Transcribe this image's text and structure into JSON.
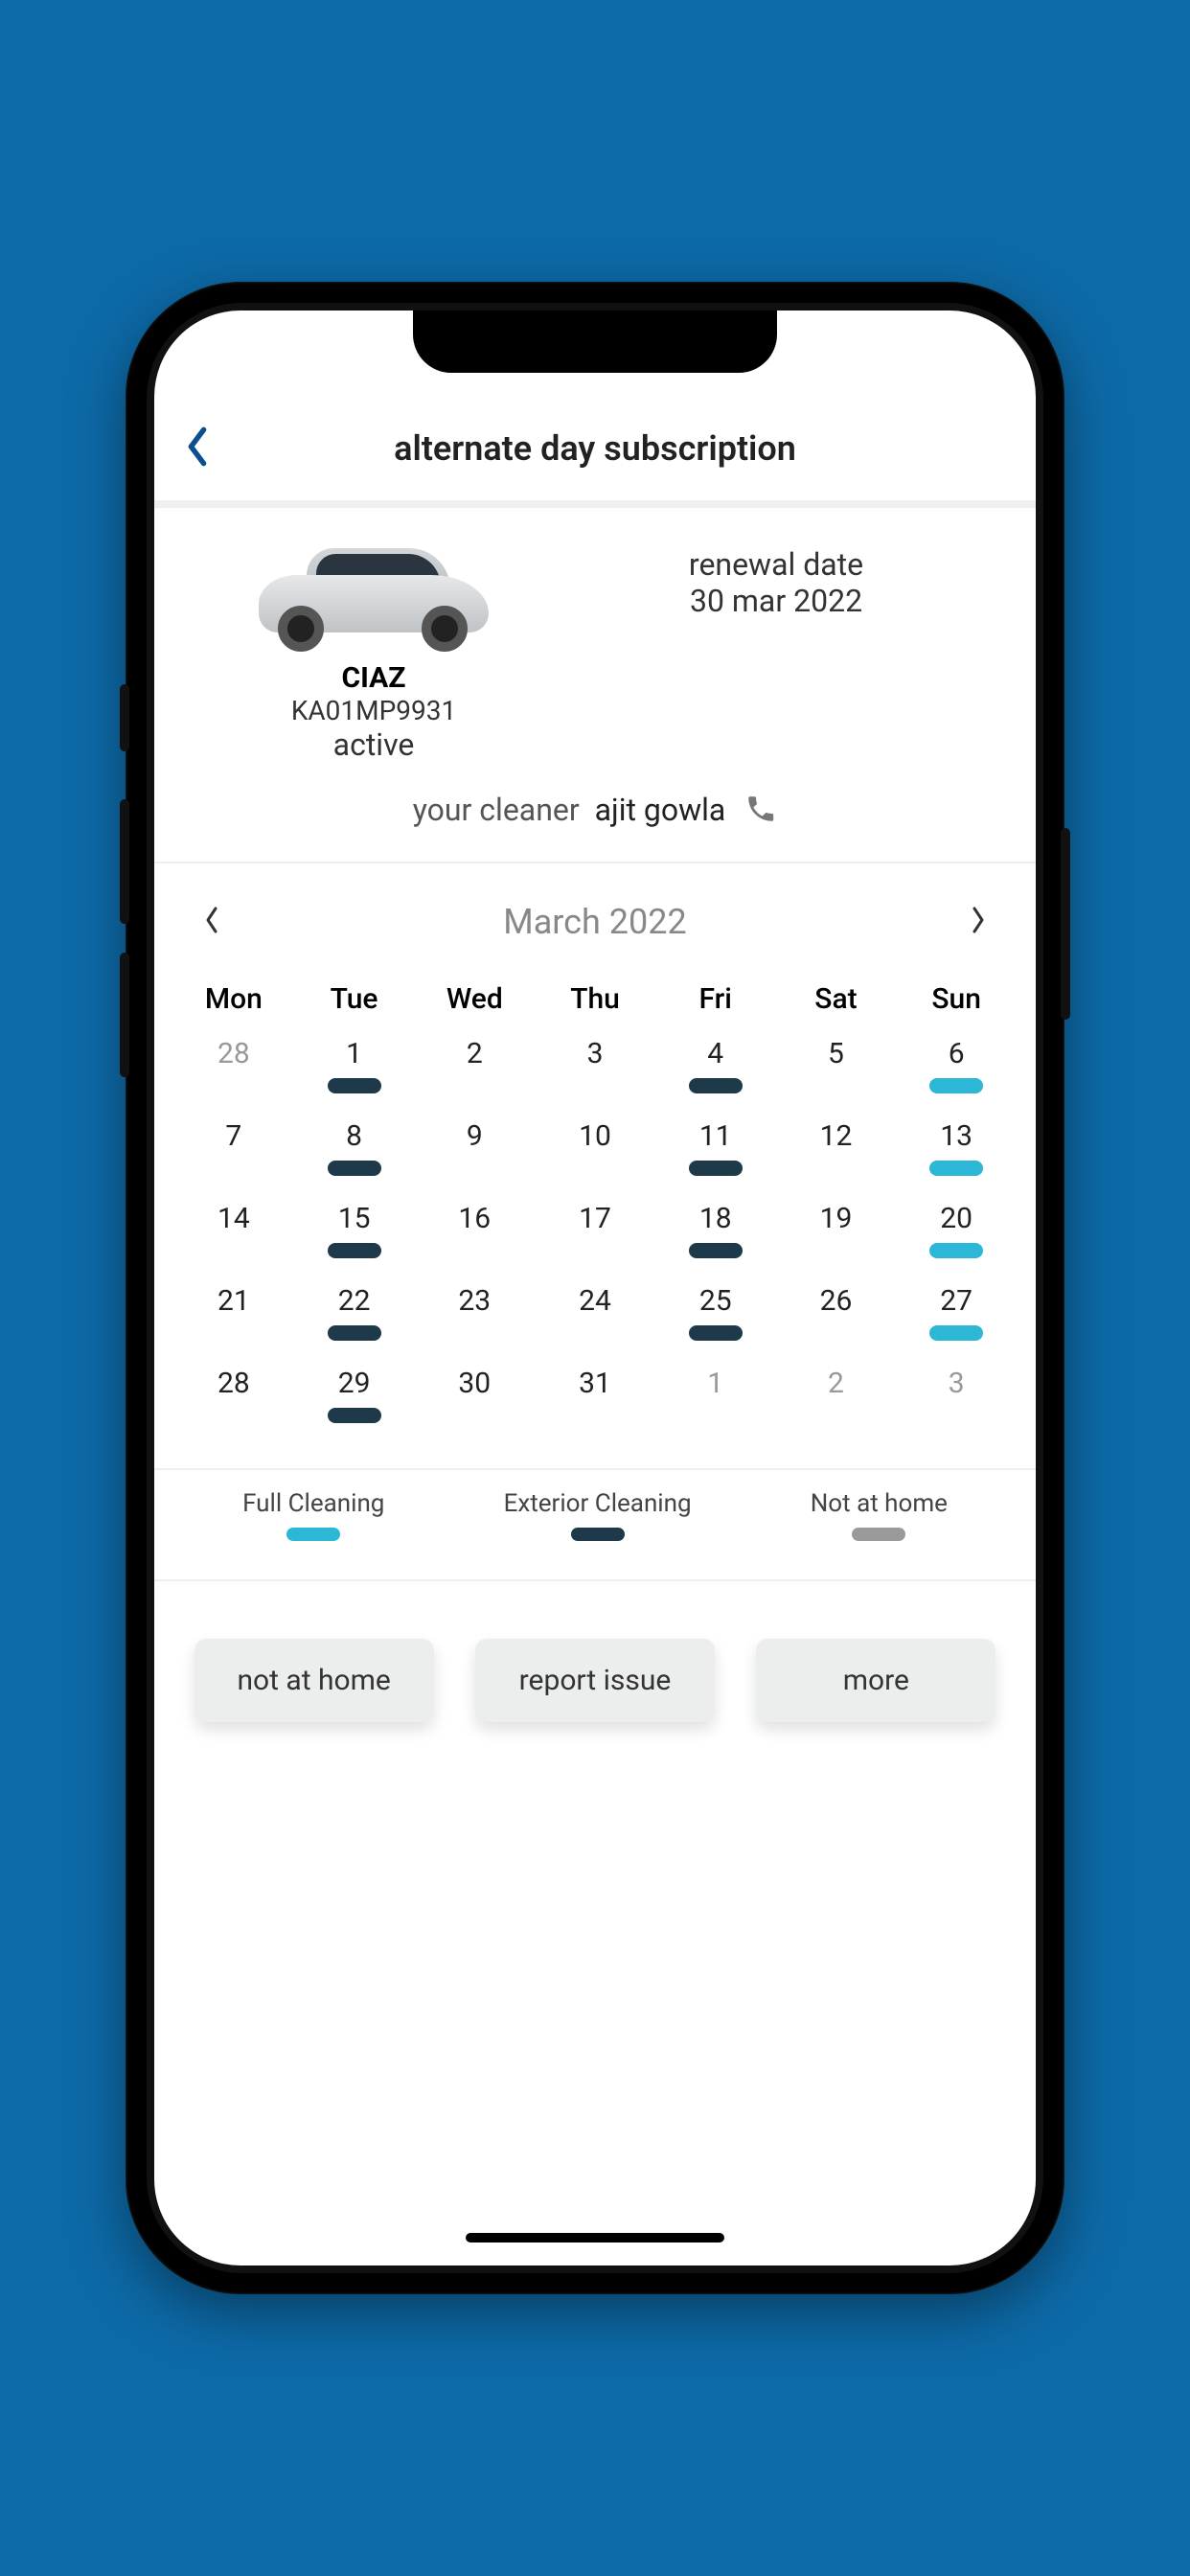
{
  "header": {
    "title": "alternate day subscription"
  },
  "car": {
    "name": "CIAZ",
    "plate": "KA01MP9931",
    "status": "active"
  },
  "renewal": {
    "label": "renewal date",
    "date": "30 mar 2022"
  },
  "cleaner": {
    "label": "your cleaner",
    "name": "ajit gowla"
  },
  "month": {
    "label": "March 2022"
  },
  "calendar": {
    "headers": [
      "Mon",
      "Tue",
      "Wed",
      "Thu",
      "Fri",
      "Sat",
      "Sun"
    ],
    "weeks": [
      [
        {
          "n": "28",
          "dim": true
        },
        {
          "n": "1",
          "pill": "ext"
        },
        {
          "n": "2"
        },
        {
          "n": "3"
        },
        {
          "n": "4",
          "pill": "ext"
        },
        {
          "n": "5"
        },
        {
          "n": "6",
          "pill": "full"
        }
      ],
      [
        {
          "n": "7"
        },
        {
          "n": "8",
          "pill": "ext"
        },
        {
          "n": "9"
        },
        {
          "n": "10"
        },
        {
          "n": "11",
          "pill": "ext"
        },
        {
          "n": "12"
        },
        {
          "n": "13",
          "pill": "full"
        }
      ],
      [
        {
          "n": "14"
        },
        {
          "n": "15",
          "pill": "ext"
        },
        {
          "n": "16"
        },
        {
          "n": "17"
        },
        {
          "n": "18",
          "pill": "ext"
        },
        {
          "n": "19"
        },
        {
          "n": "20",
          "pill": "full"
        }
      ],
      [
        {
          "n": "21"
        },
        {
          "n": "22",
          "pill": "ext"
        },
        {
          "n": "23"
        },
        {
          "n": "24"
        },
        {
          "n": "25",
          "pill": "ext"
        },
        {
          "n": "26"
        },
        {
          "n": "27",
          "pill": "full"
        }
      ],
      [
        {
          "n": "28"
        },
        {
          "n": "29",
          "pill": "ext"
        },
        {
          "n": "30"
        },
        {
          "n": "31"
        },
        {
          "n": "1",
          "dim": true
        },
        {
          "n": "2",
          "dim": true
        },
        {
          "n": "3",
          "dim": true
        }
      ]
    ]
  },
  "legend": {
    "full": "Full Cleaning",
    "ext": "Exterior Cleaning",
    "nah": "Not at home"
  },
  "actions": {
    "not_at_home": "not at home",
    "report_issue": "report issue",
    "more": "more"
  }
}
